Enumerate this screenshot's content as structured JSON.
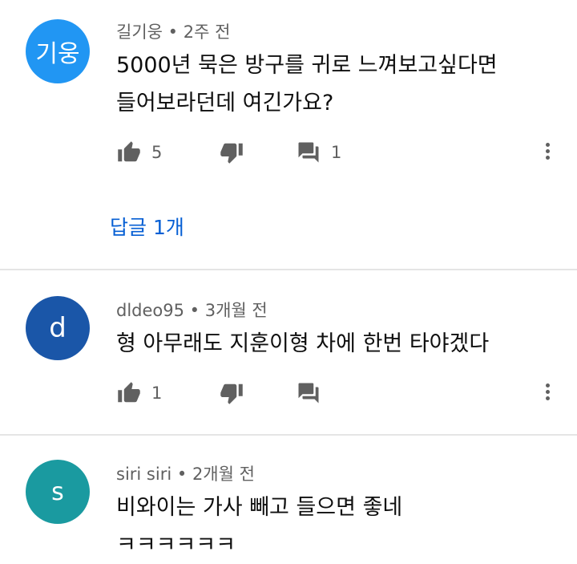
{
  "comments": [
    {
      "avatar_text": "기웅",
      "avatar_color": "#2196f3",
      "author": "길기웅",
      "time": "2주 전",
      "lines": [
        "5000년 묵은 방구를 귀로 느껴보고싶다면",
        "들어보라던데 여긴가요?"
      ],
      "likes": "5",
      "replies_count": "1",
      "reply_link": "답글 1개"
    },
    {
      "avatar_text": "d",
      "avatar_color": "#1a56a8",
      "author": "dldeo95",
      "time": "3개월 전",
      "lines": [
        "형 아무래도 지훈이형 차에 한번 타야겠다"
      ],
      "likes": "1",
      "replies_count": ""
    },
    {
      "avatar_text": "s",
      "avatar_color": "#1a9aa0",
      "author": "siri siri",
      "time": "2개월 전",
      "lines": [
        "비와이는 가사 빼고 들으면 좋네",
        "ㅋㅋㅋㅋㅋㅋ"
      ]
    }
  ],
  "separator": "•",
  "icons": {
    "like": "thumb-up-icon",
    "dislike": "thumb-down-icon",
    "reply": "comment-icon",
    "more": "more-vert-icon"
  },
  "colors": {
    "link": "#065fd4",
    "icon": "#606060",
    "divider": "#e5e5e5"
  }
}
